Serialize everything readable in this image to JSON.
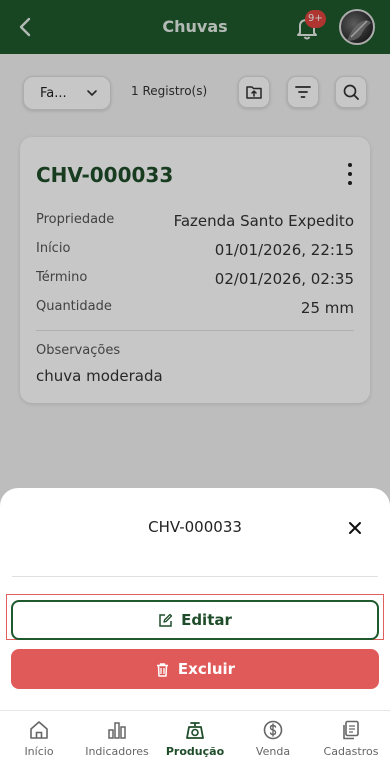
{
  "header": {
    "title": "Chuvas",
    "notification_badge": "9+"
  },
  "toolbar": {
    "filter_value": "Fa...",
    "record_count": "1 Registro(s)"
  },
  "card": {
    "code": "CHV-000033",
    "fields": [
      {
        "label": "Propriedade",
        "value": "Fazenda Santo Expedito"
      },
      {
        "label": "Início",
        "value": "01/01/2026, 22:15"
      },
      {
        "label": "Término",
        "value": "02/01/2026, 02:35"
      },
      {
        "label": "Quantidade",
        "value": "25 mm"
      }
    ],
    "observations_label": "Observações",
    "observations_value": "chuva moderada"
  },
  "sheet": {
    "title": "CHV-000033",
    "edit_label": "Editar",
    "delete_label": "Excluir"
  },
  "bottom_nav": {
    "items": [
      {
        "label": "Início",
        "icon": "home-icon"
      },
      {
        "label": "Indicadores",
        "icon": "bar-chart-icon"
      },
      {
        "label": "Produção",
        "icon": "scale-icon"
      },
      {
        "label": "Venda",
        "icon": "dollar-icon"
      },
      {
        "label": "Cadastros",
        "icon": "copy-icon"
      }
    ],
    "active": "Produção"
  },
  "colors": {
    "primary": "#1f5a2e",
    "danger": "#e15a5a",
    "badge": "#e0453f"
  }
}
